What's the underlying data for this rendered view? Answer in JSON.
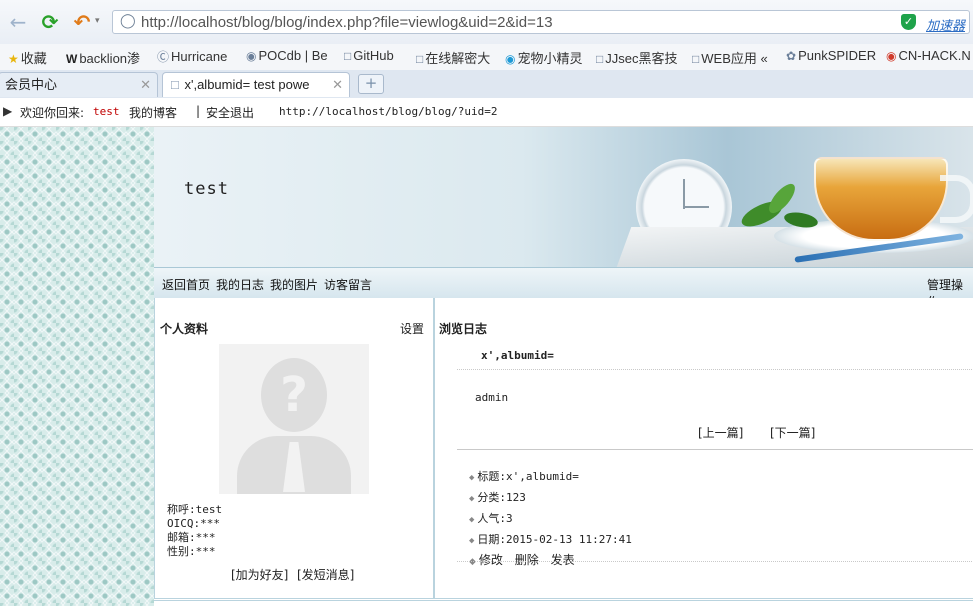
{
  "browser": {
    "url": "http://localhost/blog/blog/index.php?file=viewlog&uid=2&id=13",
    "accelerator_label": "加速器",
    "bookmarks": [
      {
        "label": "收藏",
        "icon": "star-icon"
      },
      {
        "label": "backlion渗",
        "icon": "w-logo-icon"
      },
      {
        "label": "Hurricane",
        "icon": "he-logo-icon"
      },
      {
        "label": "POCdb | Be",
        "icon": "poc-logo-icon"
      },
      {
        "label": "GitHub",
        "icon": "page-icon"
      },
      {
        "label": "在线解密大",
        "icon": "page-icon"
      },
      {
        "label": "宠物小精灵",
        "icon": "shield-icon"
      },
      {
        "label": "JJsec黑客技",
        "icon": "page-icon"
      },
      {
        "label": "WEB应用 «",
        "icon": "page-icon"
      },
      {
        "label": "PunkSPIDER",
        "icon": "spider-icon"
      },
      {
        "label": "CN-HACK.N",
        "icon": "cn-hack-icon"
      }
    ],
    "tabs": [
      {
        "label": "会员中心",
        "active": false
      },
      {
        "label": "x',albumid= test powe",
        "active": true
      }
    ],
    "new_tab_label": "+"
  },
  "page": {
    "welcome_prefix": "欢迎你回来:",
    "username": "test",
    "my_blog": "我的博客",
    "separator": "|",
    "logout": "安全退出",
    "blog_url": "http://localhost/blog/blog/?uid=2",
    "banner_title": "test",
    "nav": [
      "返回首页",
      "我的日志",
      "我的图片",
      "访客留言"
    ],
    "manage": "管理操作",
    "profile": {
      "heading": "个人资料",
      "settings": "设置",
      "lines": [
        "称呼:test",
        "OICQ:***",
        "邮箱:***",
        "性别:***"
      ],
      "add_friend": "[加为好友]",
      "send_message": "[发短消息]"
    },
    "post": {
      "heading": "浏览日志",
      "title": "x',albumid=",
      "body": "admin",
      "prev": "[上一篇]",
      "next": "[下一篇]",
      "meta": [
        "标题:x',albumid=",
        "分类:123",
        "人气:3",
        "日期:2015-02-13 11:27:41"
      ],
      "actions": [
        "修改",
        "删除",
        "发表"
      ]
    }
  },
  "colors": {
    "accent_green": "#2aa12a",
    "link_blue": "#1a73d9",
    "panel_border": "#b9d3de",
    "username_red": "#c00000"
  }
}
